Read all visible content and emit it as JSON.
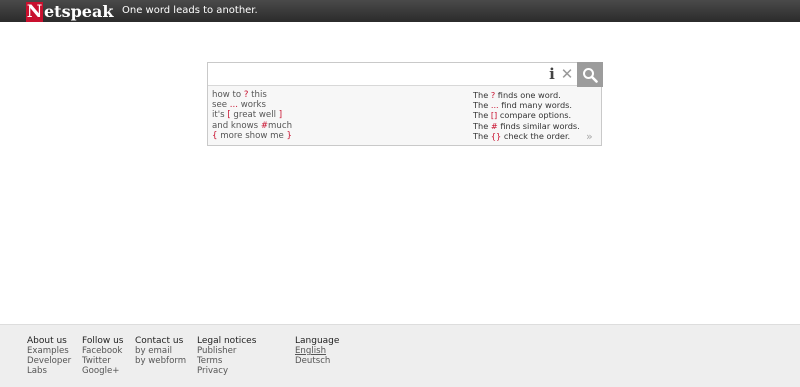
{
  "header": {
    "logo_first": "N",
    "logo_rest": "etspeak",
    "tagline": "One word leads to another."
  },
  "search": {
    "value": "",
    "placeholder": "",
    "info_glyph": "i",
    "clear_glyph": "✕",
    "examples": [
      [
        {
          "t": "how to ",
          "op": false
        },
        {
          "t": "?",
          "op": true
        },
        {
          "t": " this",
          "op": false
        }
      ],
      [
        {
          "t": "see ",
          "op": false
        },
        {
          "t": "...",
          "op": true
        },
        {
          "t": " works",
          "op": false
        }
      ],
      [
        {
          "t": "it's ",
          "op": false
        },
        {
          "t": "[",
          "op": true
        },
        {
          "t": " great well ",
          "op": false
        },
        {
          "t": "]",
          "op": true
        }
      ],
      [
        {
          "t": "and knows ",
          "op": false
        },
        {
          "t": "#",
          "op": true
        },
        {
          "t": "much",
          "op": false
        }
      ],
      [
        {
          "t": "{",
          "op": true
        },
        {
          "t": " more show me ",
          "op": false
        },
        {
          "t": "}",
          "op": true
        }
      ]
    ],
    "hints": [
      [
        {
          "t": "The ",
          "op": false
        },
        {
          "t": "?",
          "op": true
        },
        {
          "t": " finds one word.",
          "op": false
        }
      ],
      [
        {
          "t": "The ",
          "op": false
        },
        {
          "t": "...",
          "op": true
        },
        {
          "t": " find many words.",
          "op": false
        }
      ],
      [
        {
          "t": "The ",
          "op": false
        },
        {
          "t": "[]",
          "op": true
        },
        {
          "t": " compare options.",
          "op": false
        }
      ],
      [
        {
          "t": "The ",
          "op": false
        },
        {
          "t": "#",
          "op": true
        },
        {
          "t": " finds similar words.",
          "op": false
        }
      ],
      [
        {
          "t": "The ",
          "op": false
        },
        {
          "t": "{}",
          "op": true
        },
        {
          "t": " check the order.",
          "op": false
        }
      ]
    ],
    "more_glyph": "»"
  },
  "footer": {
    "about": {
      "title": "About us",
      "items": [
        "Examples",
        "Developer",
        "Labs"
      ]
    },
    "follow": {
      "title": "Follow us",
      "items": [
        "Facebook",
        "Twitter",
        "Google+"
      ]
    },
    "contact": {
      "title": "Contact us",
      "items": [
        "by email",
        "by webform"
      ]
    },
    "legal": {
      "title": "Legal notices",
      "items": [
        "Publisher",
        "Terms",
        "Privacy"
      ]
    },
    "language": {
      "title": "Language",
      "items": [
        "English",
        "Deutsch"
      ],
      "selected": "English"
    }
  },
  "colors": {
    "brand_red": "#c8102e",
    "header_bg": "#2b2b2b",
    "search_button_bg": "#9c9c9c",
    "footer_bg": "#eeeeee"
  }
}
